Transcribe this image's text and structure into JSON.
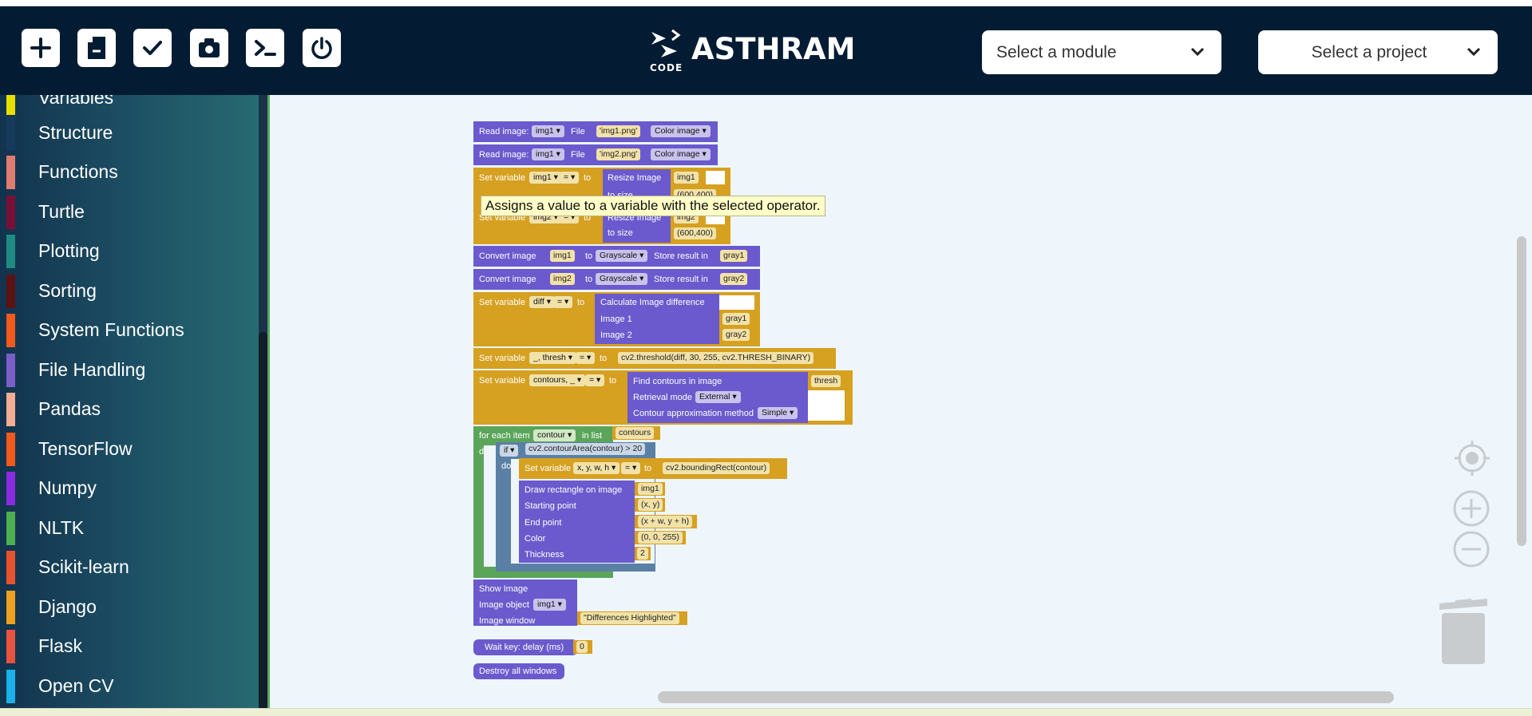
{
  "toolbar": {
    "buttons": [
      {
        "name": "new",
        "icon": "plus-icon"
      },
      {
        "name": "open",
        "icon": "file-icon"
      },
      {
        "name": "check",
        "icon": "check-icon"
      },
      {
        "name": "snapshot",
        "icon": "camera-icon"
      },
      {
        "name": "terminal",
        "icon": "terminal-icon"
      },
      {
        "name": "power",
        "icon": "power-icon"
      }
    ]
  },
  "logo": {
    "word": "ASTHRAM",
    "sub": "CODE"
  },
  "selects": {
    "module": "Select a module",
    "project": "Select a project"
  },
  "sidebar": {
    "items": [
      {
        "label": "Variables",
        "color": "#e8e000"
      },
      {
        "label": "Structure",
        "color": "#153a5c"
      },
      {
        "label": "Functions",
        "color": "#e07b6f"
      },
      {
        "label": "Turtle",
        "color": "#7a0f35"
      },
      {
        "label": "Plotting",
        "color": "#1f8b83"
      },
      {
        "label": "Sorting",
        "color": "#5c1212"
      },
      {
        "label": "System Functions",
        "color": "#f05a1c"
      },
      {
        "label": "File Handling",
        "color": "#7b5fc9"
      },
      {
        "label": "Pandas",
        "color": "#f4ad92"
      },
      {
        "label": "TensorFlow",
        "color": "#f05a1c"
      },
      {
        "label": "Numpy",
        "color": "#8a2be2"
      },
      {
        "label": "NLTK",
        "color": "#4caf50"
      },
      {
        "label": "Scikit-learn",
        "color": "#e8532f"
      },
      {
        "label": "Django",
        "color": "#f0a020"
      },
      {
        "label": "Flask",
        "color": "#e8533f"
      },
      {
        "label": "Open CV",
        "color": "#1ab0e8"
      }
    ]
  },
  "tooltip": "Assigns a value to a variable with the selected operator.",
  "blocks": {
    "read1": {
      "label": "Read image:",
      "var": "img1",
      "file": "File",
      "path": "'img1.png'",
      "mode": "Color image"
    },
    "read2": {
      "label": "Read image:",
      "var": "img1",
      "file": "File",
      "path": "'img2.png'",
      "mode": "Color image"
    },
    "set1": {
      "label": "Set variable",
      "var": "img1",
      "op": "=",
      "to": "to",
      "resize": "Resize Image",
      "src": "img1",
      "tosize": "to size",
      "size": "(600,400)"
    },
    "set2": {
      "label": "Set variable",
      "var": "img2",
      "op": "=",
      "to": "to",
      "resize": "Resize Image",
      "src": "img2",
      "tosize": "to size",
      "size": "(600,400)"
    },
    "conv1": {
      "label": "Convert image",
      "src": "img1",
      "to": "to",
      "mode": "Grayscale",
      "store": "Store result in",
      "dst": "gray1"
    },
    "conv2": {
      "label": "Convert image",
      "src": "img2",
      "to": "to",
      "mode": "Grayscale",
      "store": "Store result in",
      "dst": "gray2"
    },
    "setdiff": {
      "label": "Set variable",
      "var": "diff",
      "op": "=",
      "to": "to",
      "calc": "Calculate Image difference",
      "img1": "Image 1",
      "v1": "gray1",
      "img2": "Image 2",
      "v2": "gray2"
    },
    "setthresh": {
      "label": "Set variable",
      "var": "_, thresh",
      "op": "=",
      "to": "to",
      "expr": "cv2.threshold(diff, 30, 255, cv2.THRESH_BINARY)"
    },
    "setcont": {
      "label": "Set variable",
      "var": "contours, _",
      "op": "=",
      "to": "to",
      "find": "Find contours in image",
      "src": "thresh",
      "retr": "Retrieval mode",
      "retrv": "External",
      "approx": "Contour approximation method",
      "approxv": "Simple"
    },
    "foreach": {
      "label": "for each item",
      "var": "contour",
      "inlist": "in list",
      "list": "contours",
      "do": "do"
    },
    "ifblk": {
      "label": "if",
      "cond": "cv2.contourArea(contour) > 20",
      "do": "do"
    },
    "setbox": {
      "label": "Set variable",
      "var": "x, y, w, h",
      "op": "=",
      "to": "to",
      "expr": "cv2.boundingRect(contour)"
    },
    "rect": {
      "label": "Draw rectangle on image",
      "img": "img1",
      "start": "Starting point",
      "startv": "(x, y)",
      "end": "End point",
      "endv": "(x + w, y + h)",
      "color": "Color",
      "colorv": "(0, 0, 255)",
      "thick": "Thickness",
      "thickv": "2"
    },
    "show": {
      "label": "Show Image",
      "obj": "Image object",
      "objv": "img1",
      "win": "Image window",
      "winv": "\"Differences Highlighted\""
    },
    "wait": {
      "label": "Wait key: delay (ms)",
      "val": "0"
    },
    "destroy": {
      "label": "Destroy all windows"
    }
  },
  "controls": {
    "center": "crosshair-icon",
    "zoomin": "zoom-in-icon",
    "zoomout": "zoom-out-icon",
    "trash": "trash-icon"
  }
}
